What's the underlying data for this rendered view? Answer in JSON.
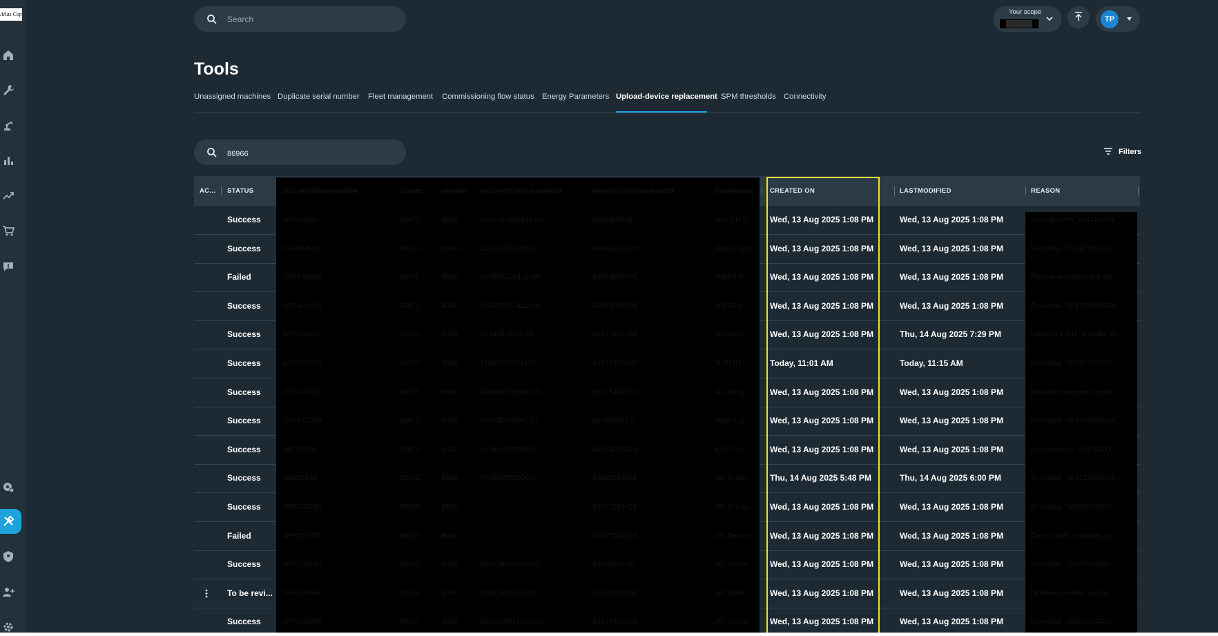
{
  "sidebar": {
    "logo": "Atlas Copco",
    "items": [
      {
        "icon": "home-icon"
      },
      {
        "icon": "wrench-icon"
      },
      {
        "icon": "robot-arm-icon"
      },
      {
        "icon": "bar-chart-icon"
      },
      {
        "icon": "trend-line-icon"
      },
      {
        "icon": "cart-icon"
      },
      {
        "icon": "chat-alert-icon"
      },
      {
        "icon": "settings-badge-icon"
      },
      {
        "icon": "tools-icon",
        "active": true
      },
      {
        "icon": "shield-icon"
      },
      {
        "icon": "add-user-icon"
      },
      {
        "icon": "gear-icon"
      }
    ],
    "active_color": "#1ea2dd"
  },
  "header": {
    "search_placeholder": "Search",
    "scope_label": "Your scope",
    "scope_value": "██████",
    "user_initials": "TP"
  },
  "page": {
    "title": "Tools",
    "tabs": [
      "Unassigned machines",
      "Duplicate serial number",
      "Fleet management",
      "Commissioning flow status",
      "Energy Parameters",
      "Upload-device replacement",
      "SPM thresholds",
      "Connectivity"
    ],
    "active_tab": "Upload-device replacement",
    "filter_search_value": "86966",
    "filters_label": "Filters"
  },
  "table": {
    "columns": {
      "actions": "AC...",
      "status": "STATUS",
      "created_on": "CREATED ON",
      "last_modified": "LASTMODIFIED",
      "reason": "REASON"
    },
    "redacted_columns": [
      "MACHINESERIALNUMBER",
      "OLDIMEI",
      "NEWIMEI",
      "OLDDEVICESERIALNUMBER",
      "NEWDEVICESERIALNUMBER",
      "COMPANYNA..."
    ],
    "rows": [
      {
        "status": "Success",
        "created": "Wed, 13 Aug 2025 1:08 PM",
        "modified": "Wed, 13 Aug 2025 1:08 PM",
        "redacted": [
          "API494388",
          "35472...",
          "8698...",
          "VUI215790041510",
          "54684090187",
          "SOUTH E..."
        ],
        "reason": "SmartboxPro \"354723094..."
      },
      {
        "status": "Success",
        "created": "Wed, 13 Aug 2025 1:08 PM",
        "modified": "Wed, 13 Aug 2025 1:08 PM",
        "redacted": [
          "API499514",
          "35537...",
          "8698...",
          "11110320230510",
          "54684020030",
          "Atlas Copc..."
        ],
        "reason": "Smartbox \"35537706180..."
      },
      {
        "status": "Failed",
        "created": "Wed, 13 Aug 2025 1:08 PM",
        "modified": "Wed, 13 Aug 2025 1:08 PM",
        "redacted": [
          "APF148448",
          "35472...",
          "8698...",
          "VUI307150411410",
          "54684090070",
          "WEST 1/..."
        ],
        "reason": "Review accepted, but cur..."
      },
      {
        "status": "Success",
        "created": "Wed, 13 Aug 2025 1:08 PM",
        "modified": "Wed, 13 Aug 2025 1:08 PM",
        "redacted": [
          "APF148448",
          "35472...",
          "8698...",
          "VUI307150411410",
          "54684090070",
          "WEST 1/..."
        ],
        "reason": "Smartbox \"354723094998..."
      },
      {
        "status": "Success",
        "created": "Wed, 13 Aug 2025 1:08 PM",
        "modified": "Thu, 14 Aug 2025 7:29 PM",
        "redacted": [
          "APF156287",
          "35355...",
          "8698...",
          "VUI4040470510",
          "54477910294",
          "AC Hung..."
        ],
        "reason": "cards UPDATE mistake, th..."
      },
      {
        "status": "Success",
        "created": "Today, 11:01 AM",
        "modified": "Today, 11:15 AM",
        "redacted": [
          "APF166773",
          "35537...",
          "8698...",
          "11092300811410",
          "54477330925",
          "NORTH I..."
        ],
        "reason": "Smartbox \"35537706183..."
      },
      {
        "status": "Success",
        "created": "Wed, 13 Aug 2025 1:08 PM",
        "modified": "Wed, 13 Aug 2025 1:08 PM",
        "redacted": [
          "APF170975",
          "35355...",
          "8698...",
          "VUI050750381110",
          "54477420131",
          "AC Hung..."
        ],
        "reason": "Manually accepted replac..."
      },
      {
        "status": "Success",
        "created": "Wed, 13 Aug 2025 1:08 PM",
        "modified": "Wed, 13 Aug 2025 1:08 PM",
        "redacted": [
          "APF172329",
          "35472...",
          "8698...",
          "VUI34040090710",
          "54710090121",
          "Atlas Cop..."
        ],
        "reason": "Smartbox \"354723090533..."
      },
      {
        "status": "Success",
        "created": "Wed, 13 Aug 2025 1:08 PM",
        "modified": "Wed, 13 Aug 2025 1:08 PM",
        "redacted": [
          "apf202686",
          "35472...",
          "8698...",
          "VUI41000050010",
          "54684000315",
          "EAST 2/..."
        ],
        "reason": "SmartboxPro \"354723000..."
      },
      {
        "status": "Success",
        "created": "Thu, 14 Aug 2025 5:48 PM",
        "modified": "Thu, 14 Aug 2025 6:00 PM",
        "redacted": [
          "apf203614",
          "35472...",
          "8698...",
          "VUI30555050610",
          "54880280003",
          "AC Turke..."
        ],
        "reason": "Smartbox \"354723094557..."
      },
      {
        "status": "Success",
        "created": "Wed, 13 Aug 2025 1:08 PM",
        "modified": "Wed, 13 Aug 2025 1:08 PM",
        "redacted": [
          "APF205784",
          "35537...",
          "8698...",
          "",
          "54477230423",
          "AC Scrolc..."
        ],
        "reason": "Smartbox \"35537004340..."
      },
      {
        "status": "Failed",
        "created": "Wed, 13 Aug 2025 1:08 PM",
        "modified": "Wed, 13 Aug 2025 1:08 PM",
        "redacted": [
          "APF205789",
          "35537...",
          "8698...",
          "",
          "54477230423",
          "AC Service..."
        ],
        "reason": "One or both machines ar..."
      },
      {
        "status": "Success",
        "created": "Wed, 13 Aug 2025 1:08 PM",
        "modified": "Wed, 13 Aug 2025 1:08 PM",
        "redacted": [
          "APF208108",
          "35537...",
          "8698...",
          "BHT08003502103",
          "54689530461",
          "AC Servic..."
        ],
        "reason": "Smartbox \"35537004442..."
      },
      {
        "status": "To be revi...",
        "created": "Wed, 13 Aug 2025 1:08 PM",
        "modified": "Wed, 13 Aug 2025 1:08 PM",
        "has_menu": true,
        "redacted": [
          "APF208946",
          "35539...",
          "8698...",
          "11837600471030",
          "54684030090",
          "AC NEW..."
        ],
        "reason": "Different models, old ma..."
      },
      {
        "status": "Success",
        "created": "Wed, 13 Aug 2025 1:08 PM",
        "modified": "Wed, 13 Aug 2025 1:08 PM",
        "redacted": [
          "APF209084",
          "35537...",
          "8698...",
          "BHS460014103103",
          "54477320669",
          "AC Servic..."
        ],
        "reason": "Smartbox \"35537004333..."
      }
    ]
  },
  "colors": {
    "background": "#1d2a33",
    "header_row": "#2b3a45",
    "highlight_border": "#f2e12a",
    "accent": "#1ea2dd"
  }
}
